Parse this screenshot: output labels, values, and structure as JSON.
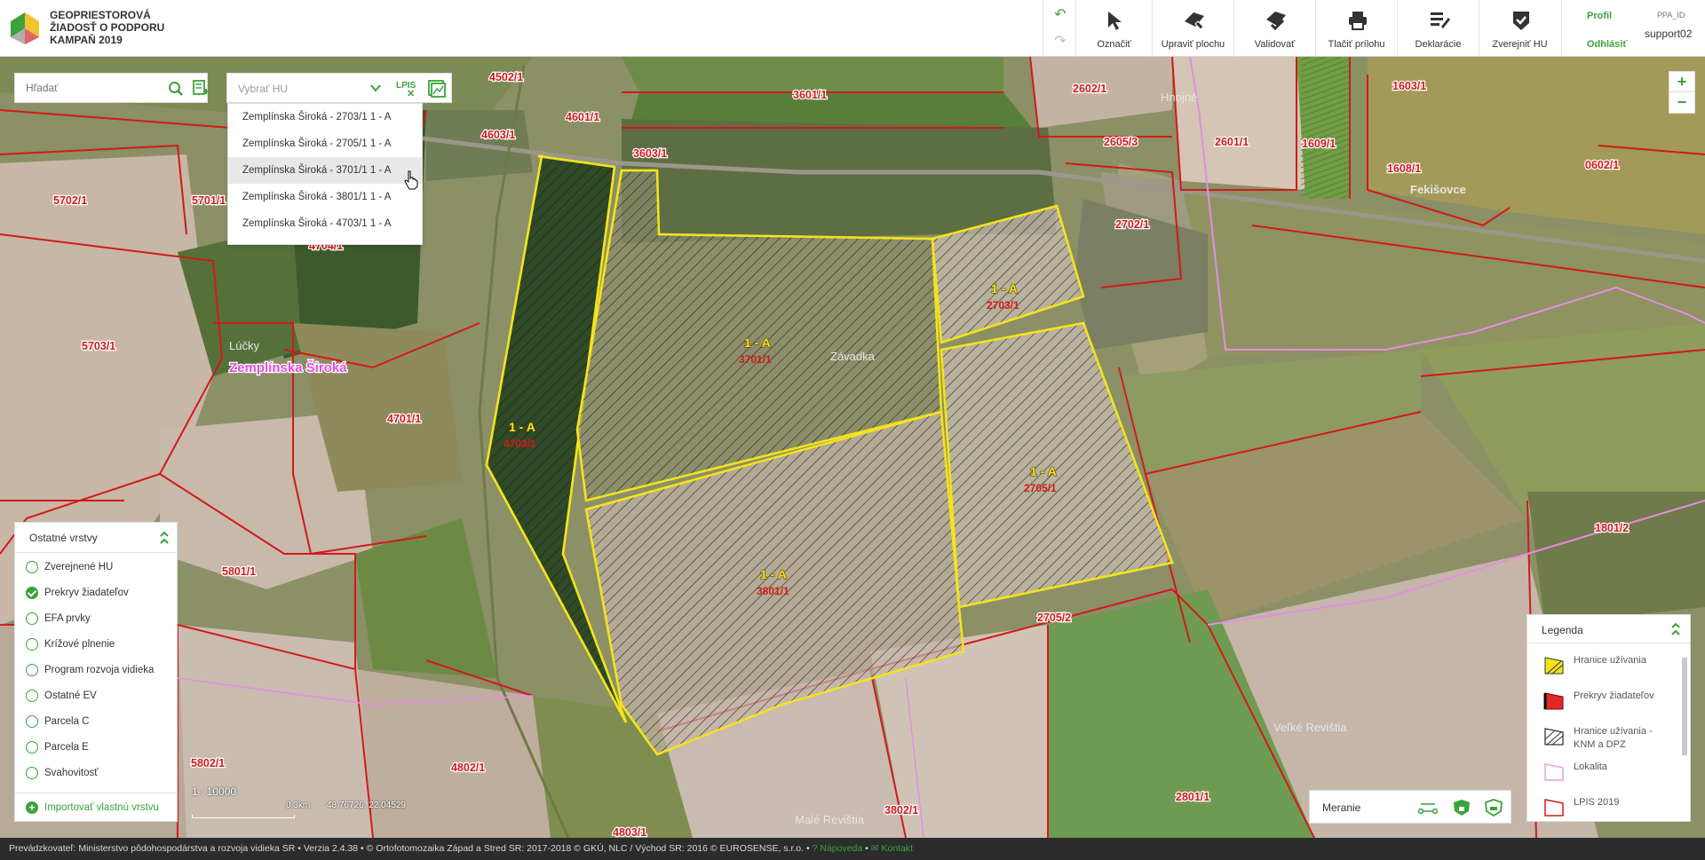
{
  "header": {
    "title_lines": [
      "GEOPRIESTOROVÁ",
      "ŽIADOSŤ O PODPORU",
      "KAMPAŇ 2019"
    ],
    "tools": [
      {
        "label": "Označiť",
        "icon": "pointer-icon"
      },
      {
        "label": "Upraviť plochu",
        "icon": "edit-area-icon"
      },
      {
        "label": "Validovať",
        "icon": "validate-icon"
      },
      {
        "label": "Tlačiť prílohu",
        "icon": "print-icon"
      },
      {
        "label": "Deklarácie",
        "icon": "declarations-icon"
      },
      {
        "label": "Zverejniť HU",
        "icon": "publish-icon"
      }
    ],
    "profile_label": "Profil",
    "logout_label": "Odhlásiť",
    "ppa_label": "PPA_ID",
    "username": "support02"
  },
  "search": {
    "placeholder": "Hľadať"
  },
  "hu_select": {
    "placeholder": "Vybrať HU",
    "lpis_label": "LPIS",
    "options": [
      "Zemplínska Široká - 2703/1 1 - A",
      "Zemplínska Široká - 2705/1 1 - A",
      "Zemplínska Široká - 3701/1 1 - A",
      "Zemplínska Široká - 3801/1 1 - A",
      "Zemplínska Široká - 4703/1 1 - A"
    ],
    "highlighted_index": 2
  },
  "zoom": {
    "in": "+",
    "out": "−"
  },
  "layers_panel": {
    "title": "Ostatné vrstvy",
    "items": [
      {
        "label": "Zverejnené HU",
        "checked": false
      },
      {
        "label": "Prekryv žiadateľov",
        "checked": true
      },
      {
        "label": "EFA prvky",
        "checked": false
      },
      {
        "label": "Krížové plnenie",
        "checked": false
      },
      {
        "label": "Program rozvoja vidieka",
        "checked": false
      },
      {
        "label": "Ostatné EV",
        "checked": false
      },
      {
        "label": "Parcela C",
        "checked": false
      },
      {
        "label": "Parcela E",
        "checked": false
      },
      {
        "label": "Svahovitosť",
        "checked": false
      }
    ],
    "import_label": "Importovať vlastnú vrstvu"
  },
  "scale": {
    "ratio": "1 : 10000",
    "bar_label": "0.3km",
    "coords": "48.76726, 22.04529"
  },
  "measure": {
    "label": "Meranie"
  },
  "legend": {
    "title": "Legenda",
    "items": [
      {
        "label": "Hranice užívania",
        "color": "#f4e31c"
      },
      {
        "label": "Prekryv žiadateľov",
        "color": "#e0282c"
      },
      {
        "label": "Hranice užívania - KNM a DPZ",
        "color": "#555555"
      },
      {
        "label": "Lokalita",
        "color": "#e6a0e6"
      },
      {
        "label": "LPIS 2019",
        "color": "#d21a1a"
      }
    ]
  },
  "map": {
    "parcel_labels": [
      "3601/1",
      "4502/1",
      "4601/1",
      "4603/1",
      "3603/1",
      "2602/1",
      "2605/3",
      "2601/1",
      "1609/1",
      "1603/1",
      "1608/1",
      "0602/1",
      "5702/1",
      "5701/1",
      "4704/1",
      "2702/1",
      "5703/1",
      "4701/1",
      "5801/1",
      "1801/2",
      "2705/2",
      "4802/1",
      "5802/1",
      "3802/1",
      "4803/1",
      "2801/1"
    ],
    "hu_blocks": [
      {
        "code": "1 - A",
        "parcel": "4703/1"
      },
      {
        "code": "1 - A",
        "parcel": "3701/1"
      },
      {
        "code": "1 - A",
        "parcel": "2703/1"
      },
      {
        "code": "1 - A",
        "parcel": "2705/1"
      },
      {
        "code": "1 - A",
        "parcel": "3801/1"
      }
    ],
    "places": [
      "Hnojné",
      "Fekišovce",
      "Lúčky",
      "Zemplínska Široká",
      "Závadka",
      "Veľké Revištia",
      "Malé Revištia"
    ]
  },
  "footer": {
    "operator": "Prevádzkovateľ: Ministerstvo pôdohospodárstva a rozvoja vidieka SR",
    "version": "Verzia 2.4.38",
    "copyright": "© Ortofotomozaika Západ a Stred SR: 2017-2018 © GKÚ, NLC / Východ SR: 2016 © EUROSENSE, s.r.o.",
    "help": "Nápoveda",
    "contact": "Kontakt"
  },
  "colors": {
    "accent": "#3aa33a",
    "lpis_border": "#d21a1a",
    "hu_border": "#f4e31c"
  }
}
